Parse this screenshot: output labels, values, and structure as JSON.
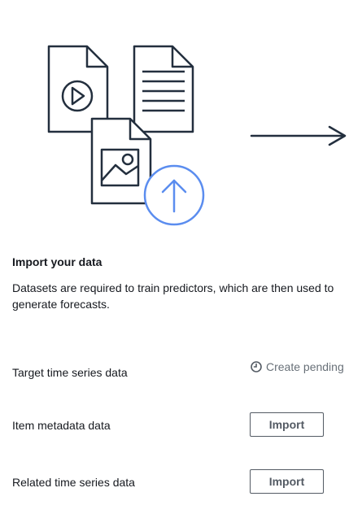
{
  "illustration": {
    "icons": [
      "video-file-icon",
      "text-document-icon",
      "image-file-icon",
      "upload-icon",
      "arrow-right-icon"
    ],
    "accent_color": "#5b8def",
    "stroke_color": "#232f3e"
  },
  "import_section": {
    "title": "Import your data",
    "description": "Datasets are required to train predictors, which are then used to generate forecasts."
  },
  "datasets": {
    "target": {
      "label": "Target time series data",
      "status": "Create pending",
      "status_icon": "clock-icon"
    },
    "item_metadata": {
      "label": "Item metadata data",
      "button": "Import"
    },
    "related": {
      "label": "Related time series data",
      "button": "Import"
    }
  }
}
